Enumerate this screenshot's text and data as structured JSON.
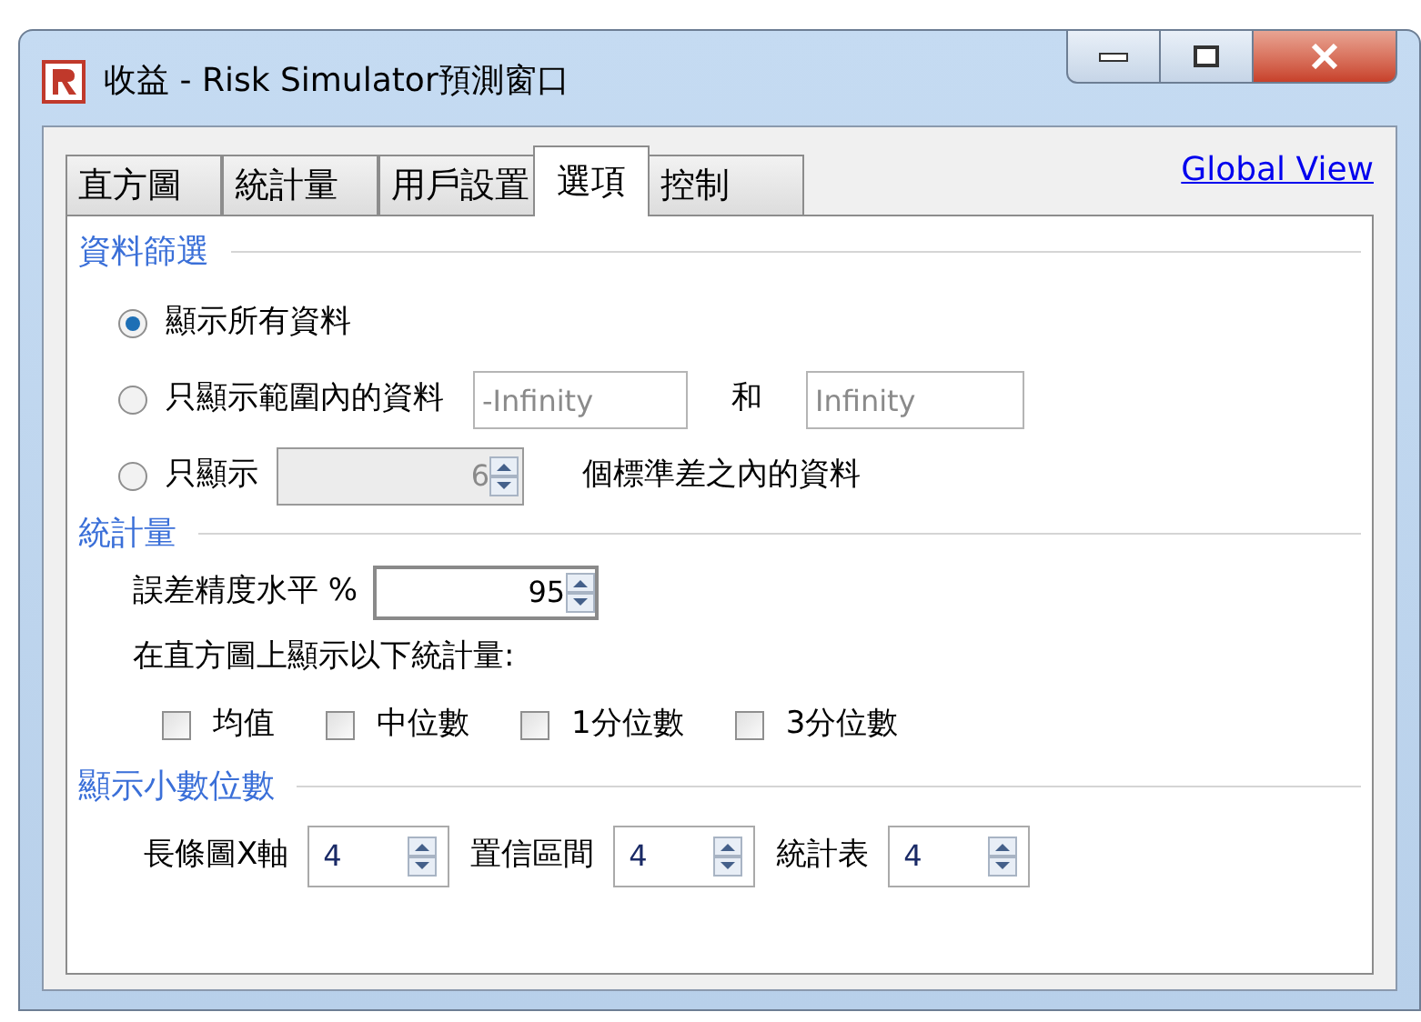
{
  "window": {
    "title": "收益 - Risk Simulator預測窗口"
  },
  "tabs": [
    {
      "label": "直方圖",
      "selected": false
    },
    {
      "label": "統計量",
      "selected": false
    },
    {
      "label": "用戶設置",
      "selected": false
    },
    {
      "label": "選項",
      "selected": true
    },
    {
      "label": "控制",
      "selected": false
    }
  ],
  "global_view_link": "Global View",
  "data_filter": {
    "title": "資料篩選",
    "options": [
      {
        "kind": "plain",
        "label": "顯示所有資料",
        "selected": true
      },
      {
        "kind": "range",
        "label": "只顯示範圍內的資料",
        "selected": false,
        "from": {
          "value": "-Infinity",
          "disabled": true
        },
        "joiner": "和",
        "to": {
          "value": "Infinity",
          "disabled": true
        }
      },
      {
        "kind": "sigma",
        "label": "只顯示",
        "selected": false,
        "spinner": {
          "value": "6",
          "disabled": true
        },
        "suffix": "個標準差之內的資料"
      }
    ]
  },
  "statistics": {
    "title": "統計量",
    "precision": {
      "label": "誤差精度水平 %",
      "value": "95"
    },
    "show_label": "在直方圖上顯示以下統計量:",
    "checkboxes": [
      {
        "label": "均值",
        "checked": false
      },
      {
        "label": "中位數",
        "checked": false
      },
      {
        "label": "1分位數",
        "checked": false
      },
      {
        "label": "3分位數",
        "checked": false
      }
    ]
  },
  "decimals": {
    "title": "顯示小數位數",
    "fields": [
      {
        "label": "長條圖X軸",
        "value": "4"
      },
      {
        "label": "置信區間",
        "value": "4"
      },
      {
        "label": "統計表",
        "value": "4"
      }
    ]
  }
}
